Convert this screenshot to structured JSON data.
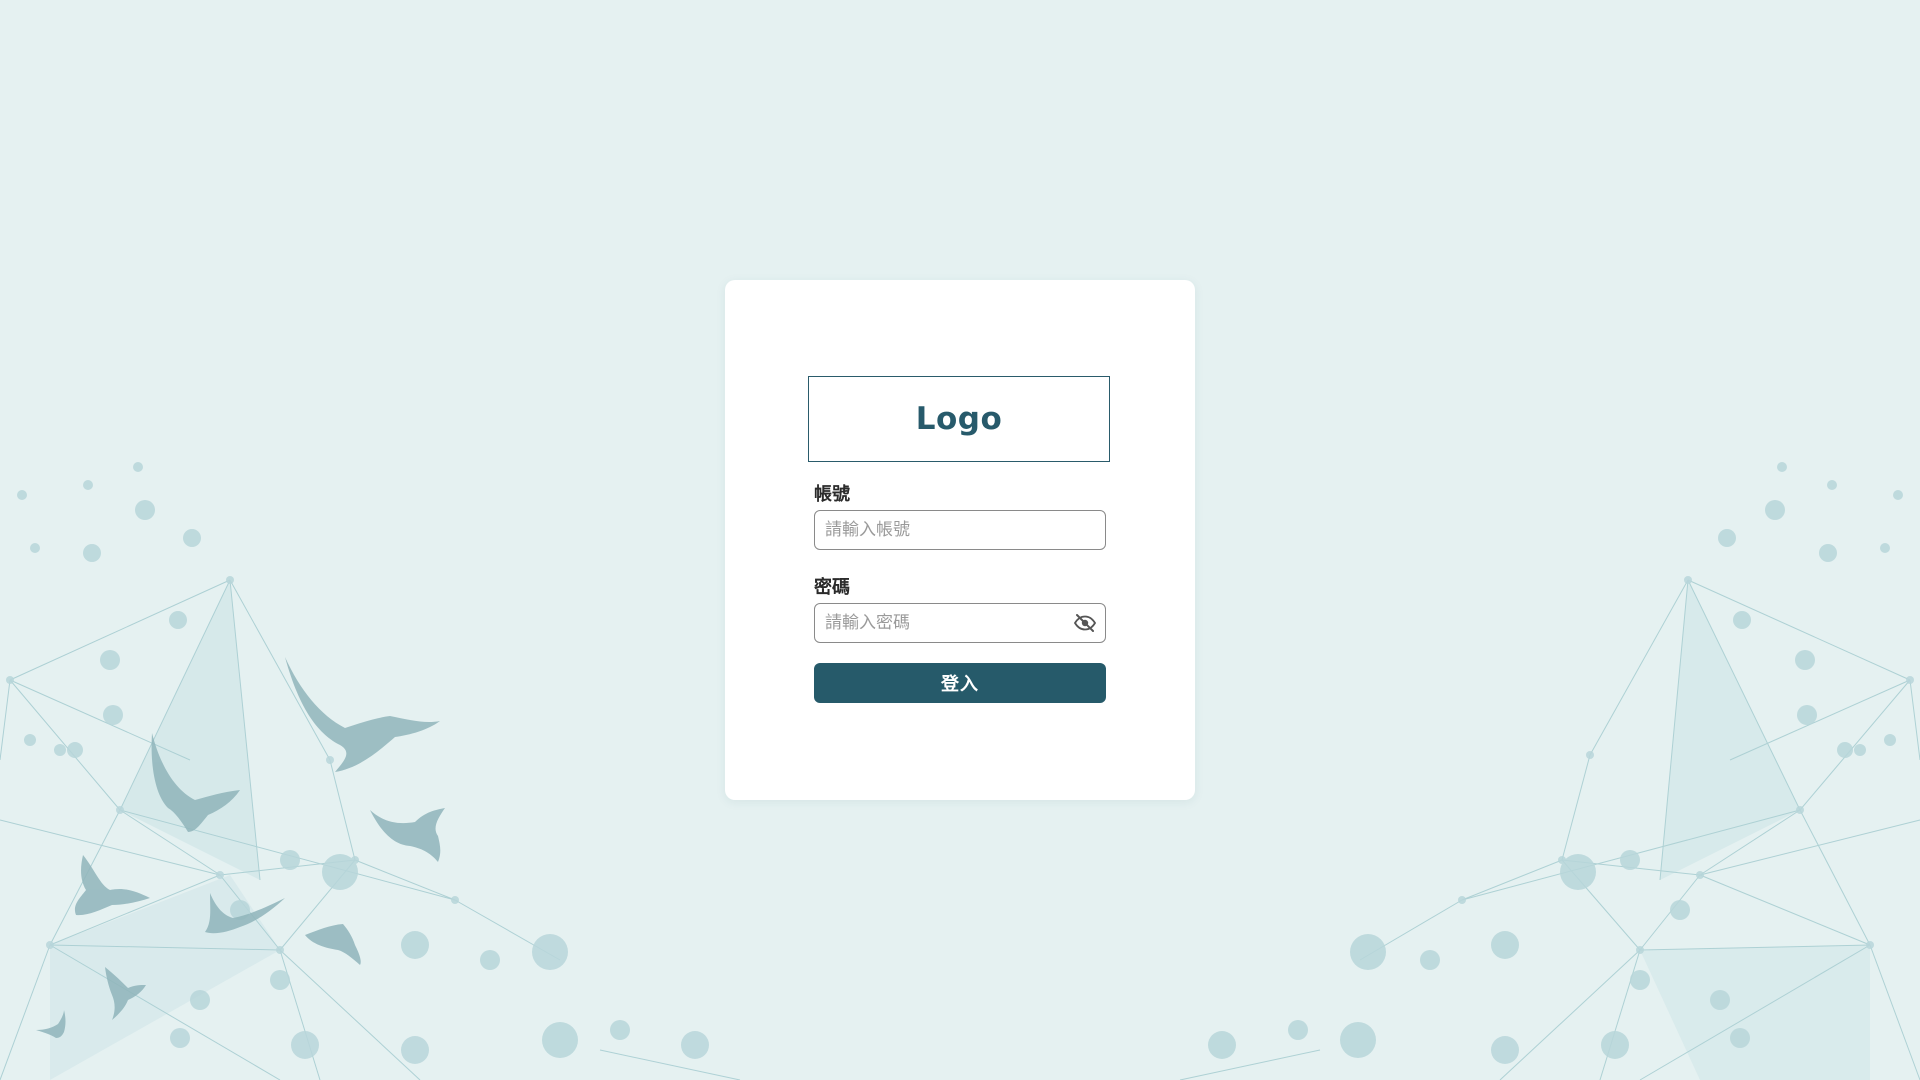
{
  "login": {
    "logo_text": "Logo",
    "account": {
      "label": "帳號",
      "placeholder": "請輸入帳號",
      "value": ""
    },
    "password": {
      "label": "密碼",
      "placeholder": "請輸入密碼",
      "value": "",
      "toggle_icon": "eye-slash-icon"
    },
    "submit_label": "登入"
  },
  "theme": {
    "background": "#e5f1f1",
    "primary": "#265a6a",
    "card": "#ffffff",
    "network": "#9fc7cc",
    "birds": "#8fb4ba"
  },
  "decorations": {
    "left_icon": "network-and-birds",
    "right_icon": "network"
  }
}
